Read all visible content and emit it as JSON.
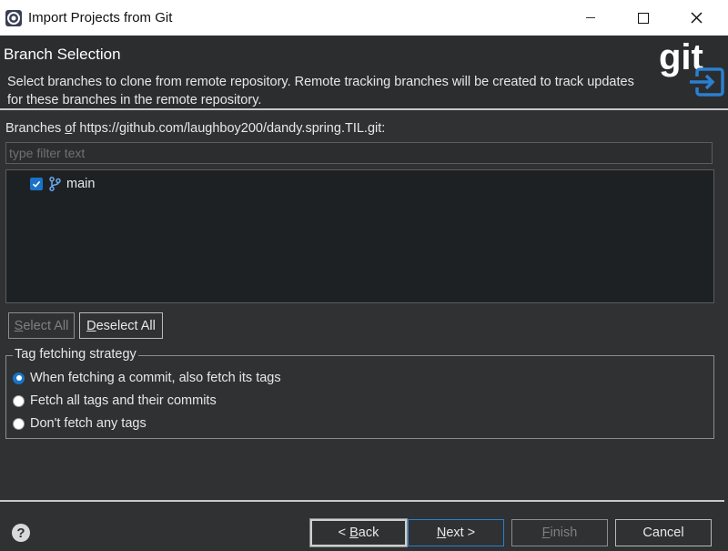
{
  "window": {
    "title": "Import Projects from Git",
    "controls": {
      "minimize": "—",
      "maximize": "☐",
      "close": "✕"
    }
  },
  "header": {
    "title": "Branch Selection",
    "description": "Select branches to clone from remote repository. Remote tracking branches will be created to track updates for these branches in the remote repository.",
    "logo_text": "git"
  },
  "branches": {
    "label_prefix": "Branches ",
    "label_mnemonic": "o",
    "label_suffix": "f https://github.com/laughboy200/dandy.spring.TIL.git:",
    "filter_placeholder": "type filter text",
    "filter_value": "",
    "items": [
      {
        "name": "main",
        "checked": true
      }
    ]
  },
  "selection_buttons": {
    "select_all_mnemonic": "S",
    "select_all_rest": "elect All",
    "deselect_all_mnemonic": "D",
    "deselect_all_rest": "eselect All"
  },
  "tag_group": {
    "legend": "Tag fetching strategy",
    "options": [
      {
        "label": "When fetching a commit, also fetch its tags",
        "selected": true
      },
      {
        "label": "Fetch all tags and their commits",
        "selected": false
      },
      {
        "label": "Don't fetch any tags",
        "selected": false
      }
    ]
  },
  "footer": {
    "back_prefix": "< ",
    "back_mnemonic": "B",
    "back_rest": "ack",
    "next_mnemonic": "N",
    "next_rest": "ext >",
    "finish_mnemonic": "F",
    "finish_rest": "inish",
    "cancel": "Cancel"
  },
  "colors": {
    "accent": "#1a73c9",
    "background": "#2f3133",
    "list_background": "#1e2124"
  }
}
